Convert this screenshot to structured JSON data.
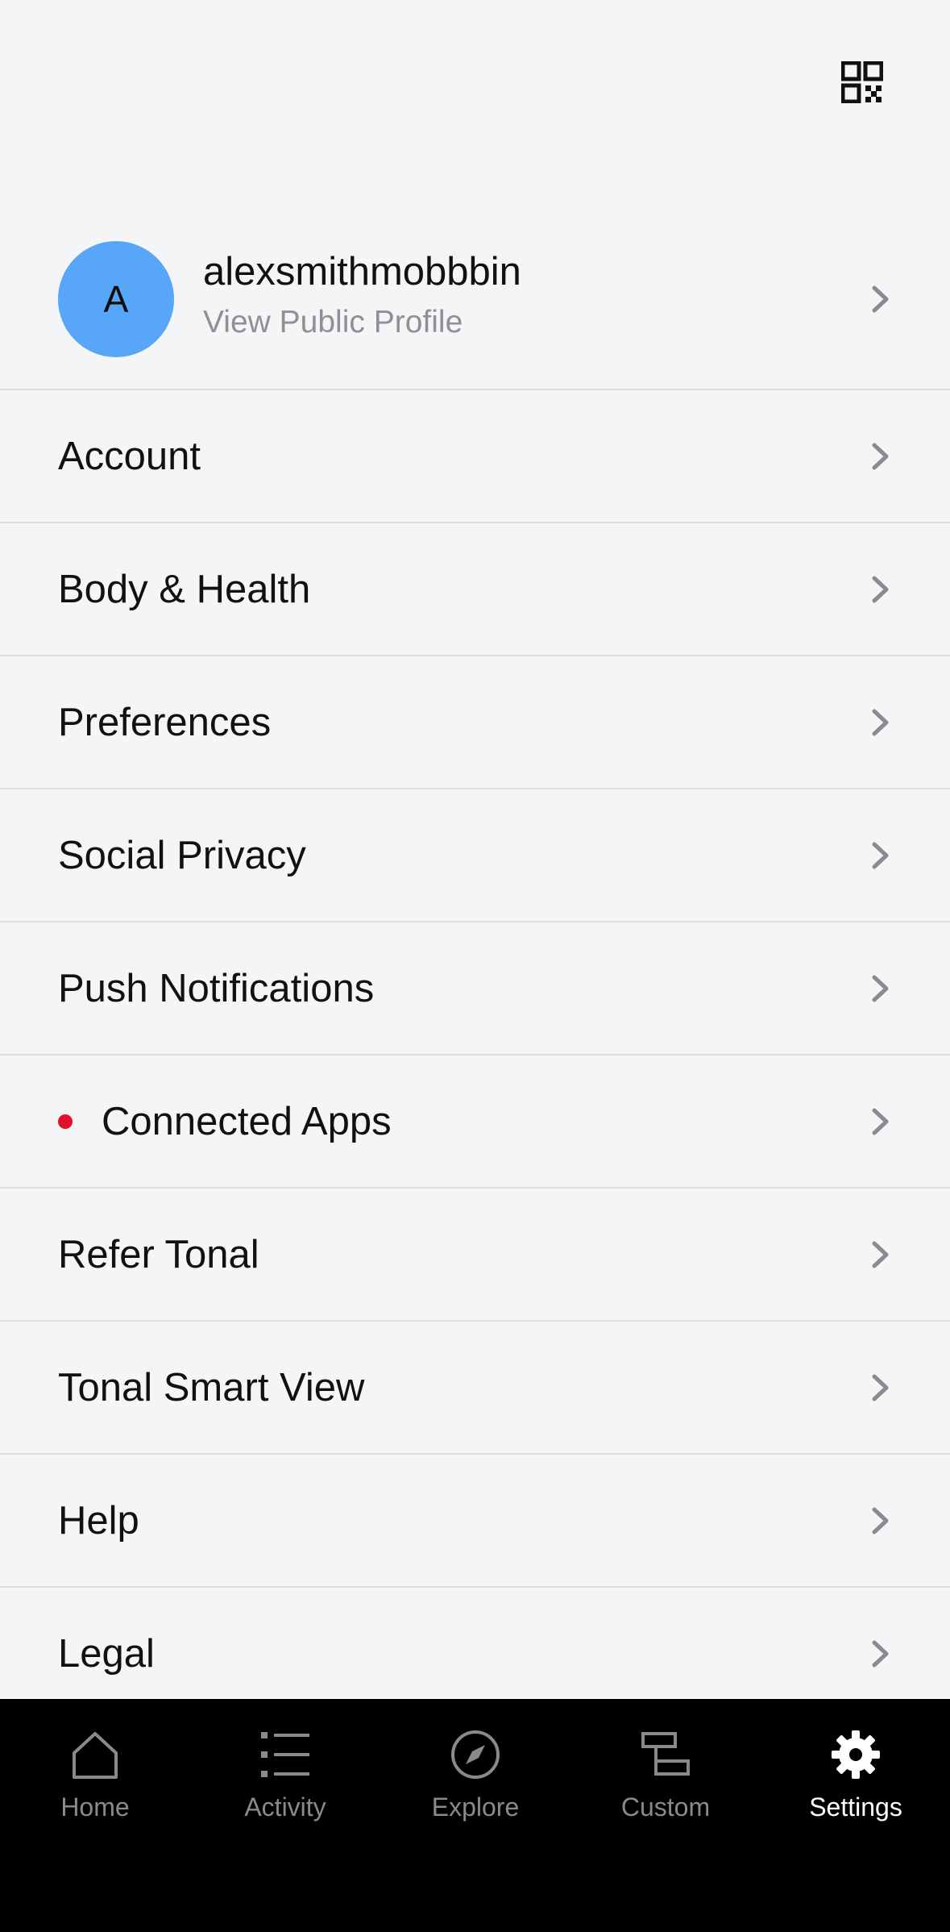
{
  "header": {
    "qr_icon": "qr-code-icon"
  },
  "profile": {
    "avatar_initial": "A",
    "avatar_color": "#57a6f7",
    "username": "alexsmithmobbbin",
    "link_label": "View Public Profile"
  },
  "menu": {
    "items": [
      {
        "label": "Account"
      },
      {
        "label": "Body & Health"
      },
      {
        "label": "Preferences"
      },
      {
        "label": "Social Privacy"
      },
      {
        "label": "Push Notifications"
      },
      {
        "label": "Connected Apps",
        "notification_dot": true,
        "dot_color": "#e0112b"
      },
      {
        "label": "Refer Tonal"
      },
      {
        "label": "Tonal Smart View"
      },
      {
        "label": "Help"
      },
      {
        "label": "Legal"
      }
    ]
  },
  "tab_bar": {
    "tabs": [
      {
        "label": "Home",
        "icon": "home-icon"
      },
      {
        "label": "Activity",
        "icon": "activity-list-icon"
      },
      {
        "label": "Explore",
        "icon": "compass-icon"
      },
      {
        "label": "Custom",
        "icon": "custom-blocks-icon"
      },
      {
        "label": "Settings",
        "icon": "gear-icon",
        "active": true
      }
    ],
    "active_color": "#ffffff",
    "inactive_color": "#8a8a8e"
  }
}
